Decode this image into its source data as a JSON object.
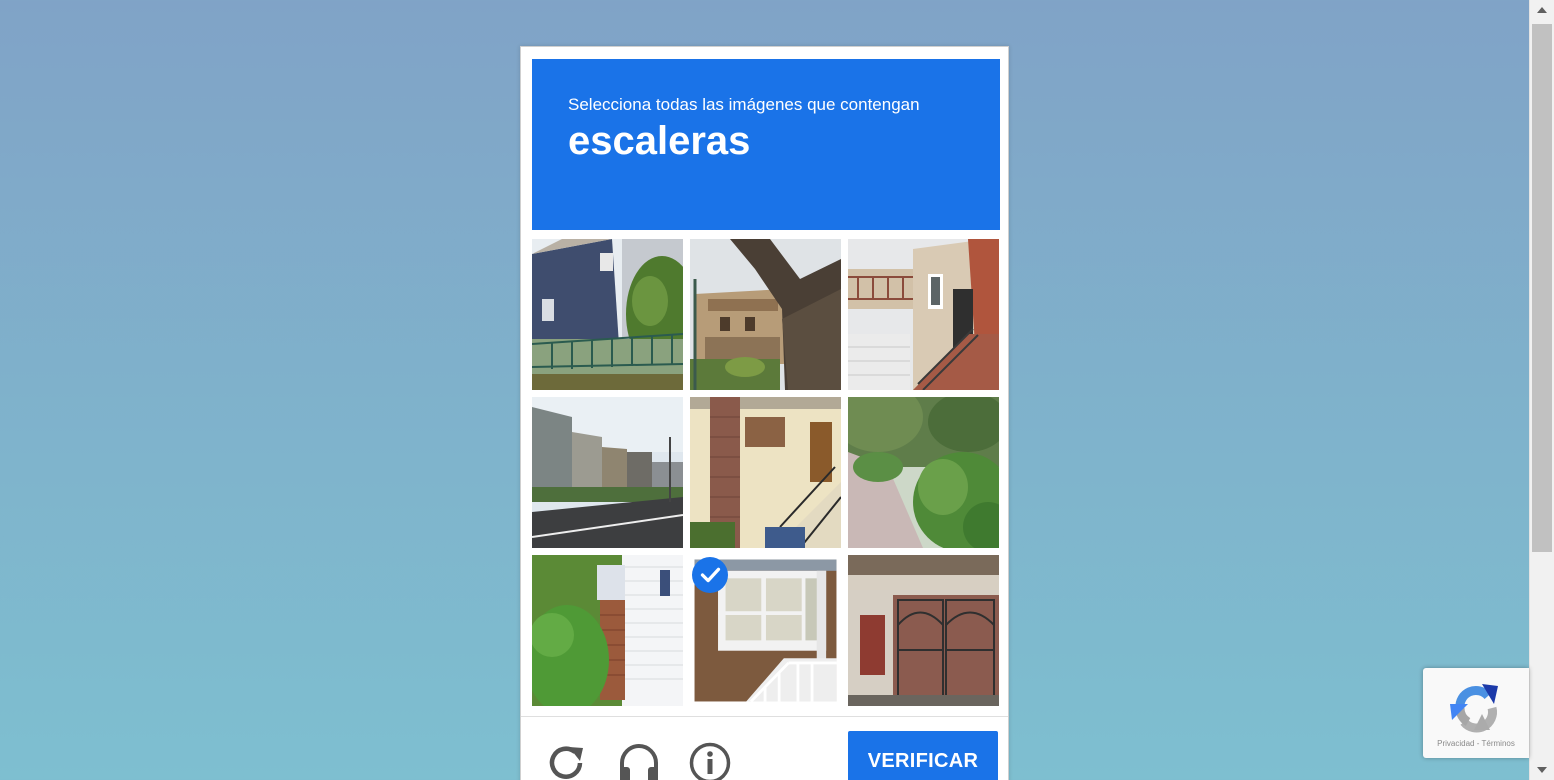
{
  "challenge": {
    "instruction": "Selecciona todas las imágenes que contengan",
    "keyword": "escaleras",
    "tiles": [
      {
        "selected": false
      },
      {
        "selected": false
      },
      {
        "selected": false
      },
      {
        "selected": false
      },
      {
        "selected": false
      },
      {
        "selected": false
      },
      {
        "selected": false
      },
      {
        "selected": true
      },
      {
        "selected": false
      }
    ],
    "verify_label": "VERIFICAR",
    "icons": [
      "reload-icon",
      "audio-icon",
      "info-icon"
    ]
  },
  "badge": {
    "privacy_link": "Privacidad",
    "separator": "-",
    "terms_link": "Términos"
  },
  "colors": {
    "accent": "#1a73e8",
    "background_top": "#80a3c7",
    "background_bottom": "#7ebfd0"
  }
}
